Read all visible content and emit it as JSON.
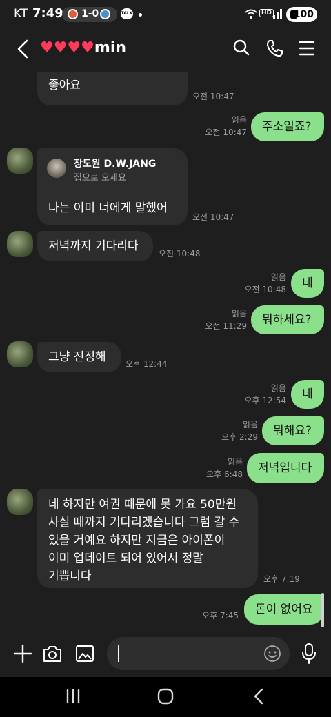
{
  "status_bar": {
    "carrier": "KT",
    "time": "7:49",
    "score": "1-0",
    "talk_badge": "TALK",
    "hd": "HD",
    "battery": "100"
  },
  "header": {
    "title_hearts": "♥♥♥♥",
    "title_name": "min"
  },
  "messages": [
    {
      "side": "recv",
      "text": "좋아요",
      "time": "오전 10:47"
    },
    {
      "side": "sent",
      "text": "주소일죠?",
      "read": "읽음",
      "time": "오전 10:47"
    },
    {
      "side": "recv",
      "reply_to_name": "장도원  D.W.JANG",
      "reply_to_text": "집으로 오세요",
      "text": "나는 이미 너에게 말했어",
      "time": "오전 10:47"
    },
    {
      "side": "recv",
      "text": "저녁까지 기다리다",
      "time": "오전 10:48"
    },
    {
      "side": "sent",
      "text": "네",
      "read": "읽음",
      "time": "오전 10:48"
    },
    {
      "side": "sent",
      "text": "뭐하세요?",
      "read": "읽음",
      "time": "오전 11:29"
    },
    {
      "side": "recv",
      "text": "그냥 진정해",
      "time": "오후 12:44"
    },
    {
      "side": "sent",
      "text": "네",
      "read": "읽음",
      "time": "오후 12:54"
    },
    {
      "side": "sent",
      "text": "뭐해요?",
      "read": "읽음",
      "time": "오후 2:29"
    },
    {
      "side": "sent",
      "text": "저녁입니다",
      "read": "읽음",
      "time": "오후 6:48"
    },
    {
      "side": "recv",
      "lines": [
        "네 하지만 여권 때문에 못 가요 50만원",
        "사실 때까지 기다리겠습니다 그럼 갈 수",
        "있을 거예요 하지만 지금은 아이폰이",
        "이미 업데이트 되어 있어서 정말",
        "기쁩니다"
      ],
      "time": "오후 7:19"
    },
    {
      "side": "sent",
      "text": "돈이 없어요",
      "time": "오후 7:45"
    }
  ],
  "input": {
    "value": ""
  },
  "icons": {
    "back": "back-arrow-icon",
    "search": "search-icon",
    "call": "phone-icon",
    "menu": "menu-icon",
    "plus": "plus-icon",
    "camera": "camera-icon",
    "gallery": "image-icon",
    "emoji": "emoji-icon",
    "mic": "microphone-icon"
  },
  "colors": {
    "background": "#1e1e1e",
    "sent_bubble": "#8be08b",
    "recv_bubble": "#2d2d2d",
    "hearts": "#ff3b5c"
  }
}
